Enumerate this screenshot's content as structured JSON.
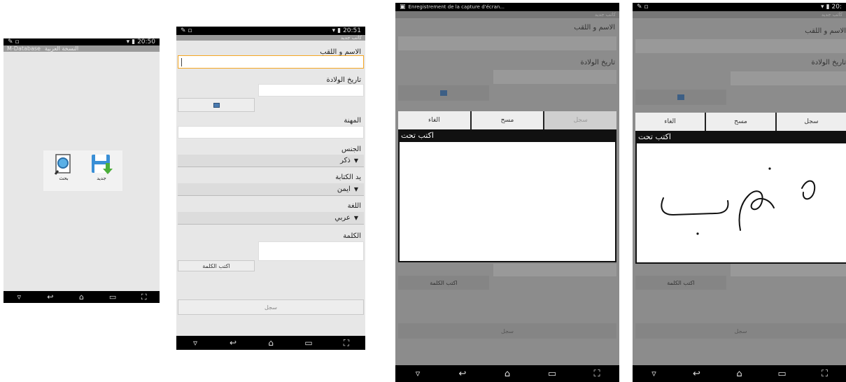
{
  "colors": {
    "accent": "#f5a623",
    "status_bar": "#000000",
    "background": "#e7e7e7",
    "dialog_header": "#111111"
  },
  "phone1": {
    "status_time": "20:50",
    "app_title": "M-Database",
    "app_subtitle": "النسخة العربية",
    "tiles": [
      {
        "label": "بحث",
        "icon": "search-document-icon"
      },
      {
        "label": "جديد",
        "icon": "save-disk-icon"
      }
    ]
  },
  "phone2": {
    "status_time": "20:51",
    "header_title": "كاتب جديد",
    "fields": {
      "name_label": "الاسم و اللقب",
      "birth_label": "تاريخ الولادة",
      "job_label": "المهنة",
      "gender_label": "الجنس",
      "gender_value": "ذكر",
      "hand_label": "يد الكتابة",
      "hand_value": "ايمن",
      "lang_label": "اللغة",
      "lang_value": "عربي",
      "word_label": "الكلمة",
      "write_word_button": "اكتب الكلمة",
      "save_button": "سجل"
    }
  },
  "phone3": {
    "status_text": "Enregistrement de la capture d'écran...",
    "header_title": "كاتب جديد",
    "name_label": "الاسم و اللقب",
    "birth_label": "تاريخ الولادة",
    "dialog": {
      "save": "سجل",
      "clear": "مسح",
      "cancel": "الغاء",
      "title": "اكتب تحت"
    },
    "write_word_button": "اكتب الكلمة",
    "save_button": "سجل"
  },
  "phone4": {
    "status_time": "20:",
    "header_title": "كاتب جديد",
    "name_label": "الاسم و اللقب",
    "birth_label": "تاريخ الولادة",
    "dialog": {
      "save": "سجل",
      "clear": "مسح",
      "cancel": "الغاء",
      "title": "اكتب تحت"
    },
    "write_word_button": "اكتب الكلمة",
    "save_button": "سجل"
  }
}
